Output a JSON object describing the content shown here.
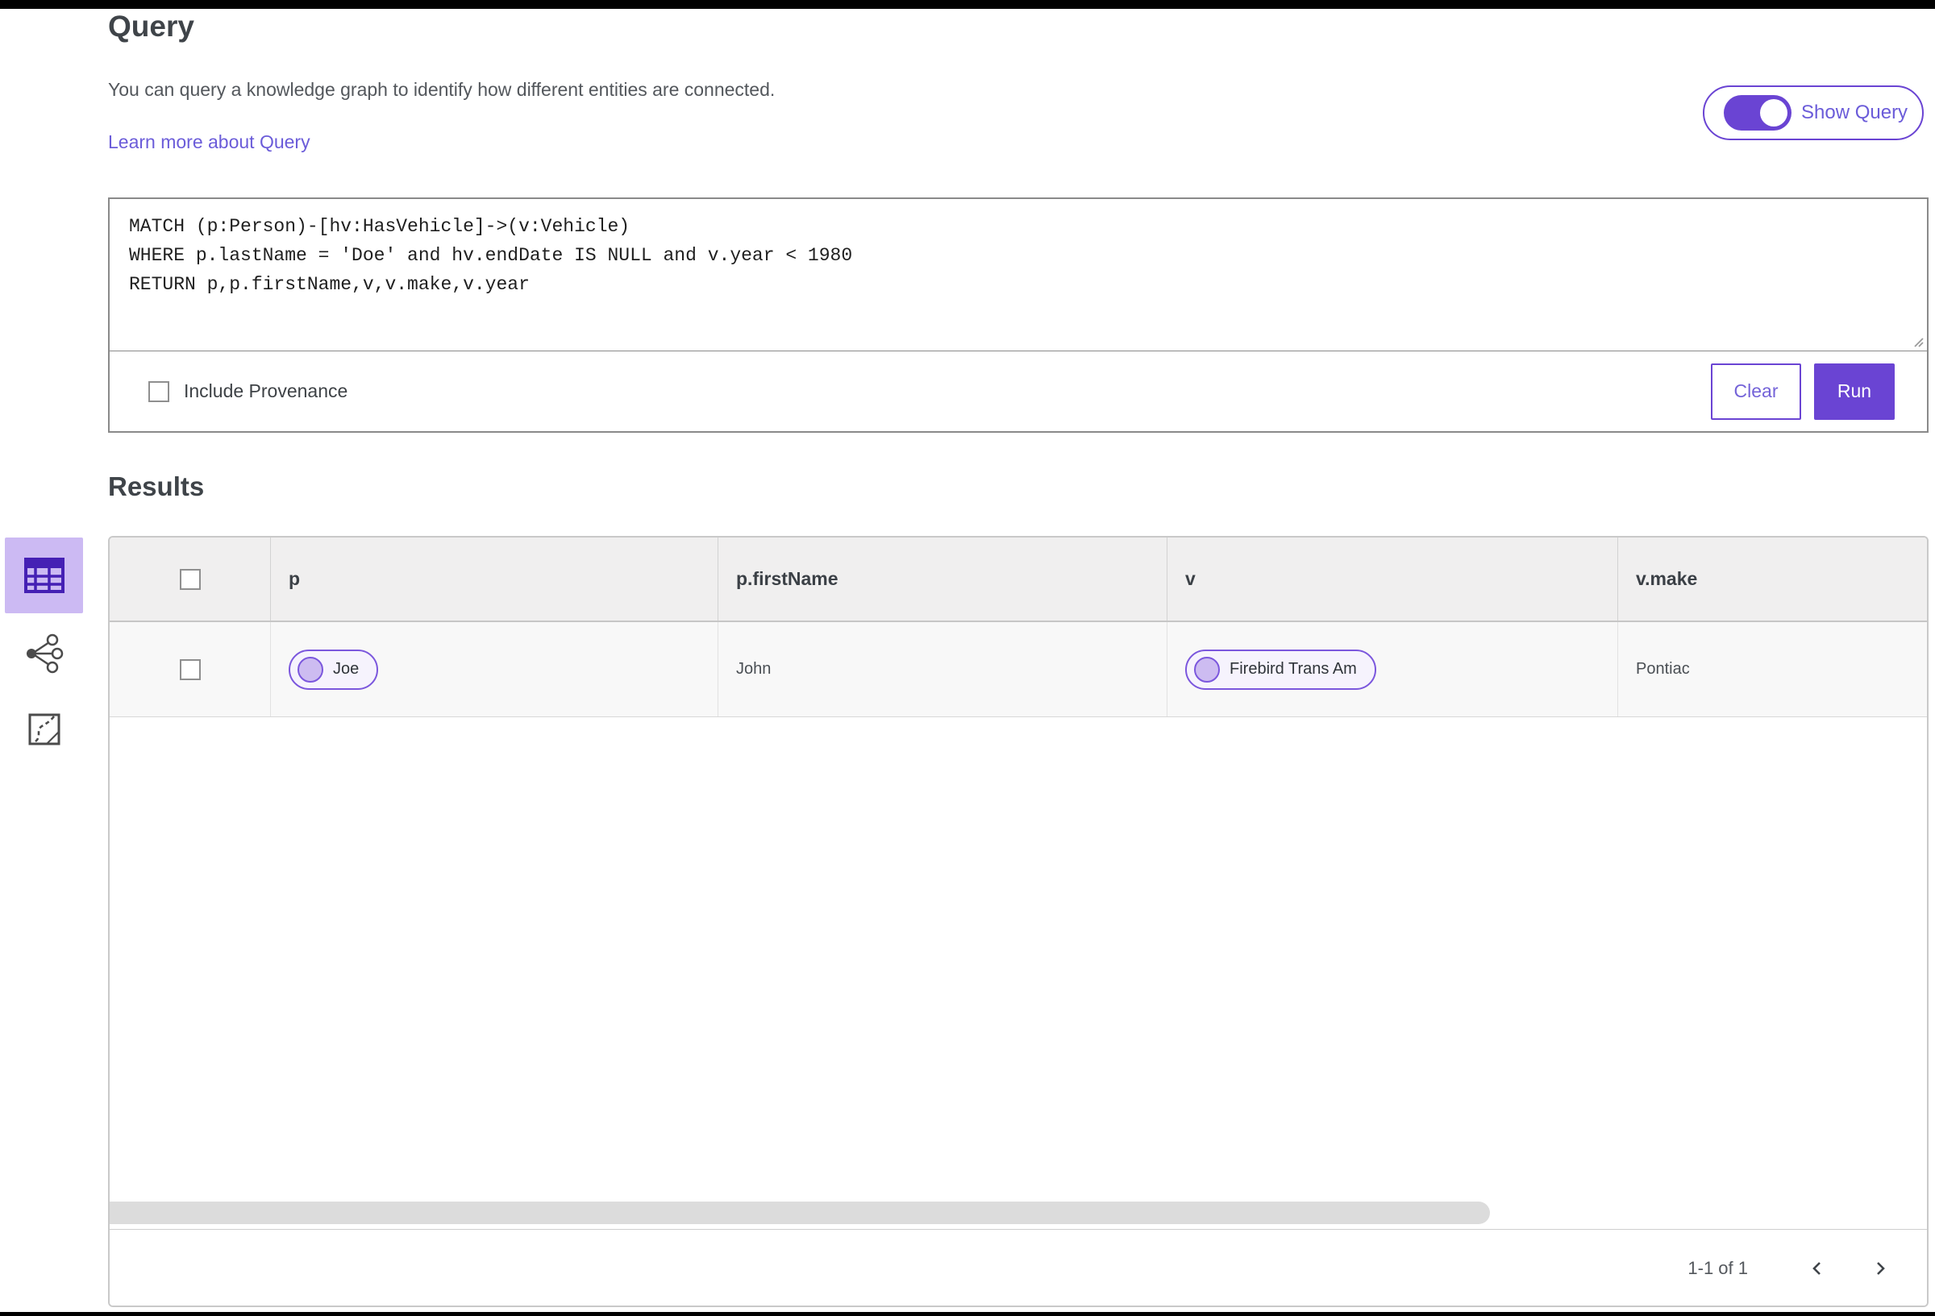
{
  "colors": {
    "accent": "#6a44d3",
    "link": "#6b5cd9",
    "lavender": "#ccbaf3",
    "pill_border": "#7b57dd",
    "pill_bg": "#f6f3fd",
    "header_bg": "#f0efef",
    "row_bg": "#f8f8f8"
  },
  "page": {
    "title": "Query",
    "description": "You can query a knowledge graph to identify how different entities are connected.",
    "learn_more_link": "Learn more about Query",
    "show_query_label": "Show Query"
  },
  "query_editor": {
    "code_lines": [
      "MATCH (p:Person)-[hv:HasVehicle]->(v:Vehicle)",
      "WHERE p.lastName = 'Doe' and hv.endDate IS NULL and v.year < 1980",
      "RETURN p,p.firstName,v,v.make,v.year"
    ],
    "include_provenance_label": "Include Provenance",
    "clear_label": "Clear",
    "run_label": "Run"
  },
  "results": {
    "heading": "Results",
    "columns": [
      "p",
      "p.firstName",
      "v",
      "v.make"
    ],
    "rows": [
      {
        "p_chip": "Joe",
        "p_firstName": "John",
        "v_chip": "Firebird Trans Am",
        "v_make": "Pontiac"
      }
    ],
    "pagination": {
      "range_label": "1-1 of 1"
    }
  }
}
